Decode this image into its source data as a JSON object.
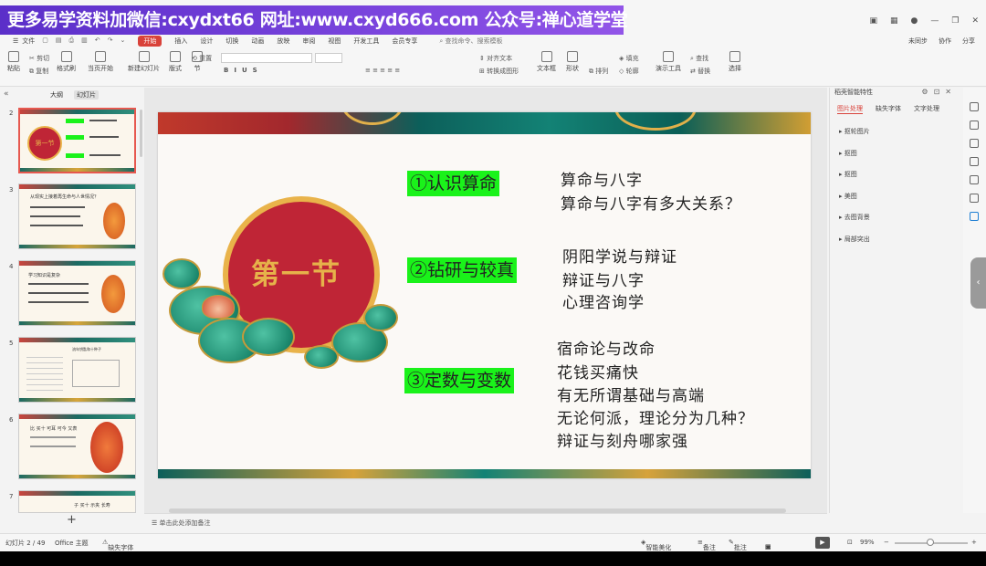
{
  "banner": {
    "text": "更多易学资料加微信:cxydxt66  网址:www.cxyd666.com  公众号:禅心道学堂"
  },
  "menu": {
    "file": "文件",
    "tabs": [
      "开始",
      "插入",
      "设计",
      "切换",
      "动画",
      "放映",
      "审阅",
      "视图",
      "开发工具",
      "会员专享"
    ],
    "active_tab": "开始",
    "search": "查找命令、搜索模板",
    "right": [
      "未同步",
      "协作",
      "分享"
    ]
  },
  "ribbon": {
    "paste": "粘贴",
    "cut": "剪切",
    "copy": "复制",
    "format_painter": "格式刷",
    "current_slide": "当页开始",
    "new_slide": "新建幻灯片",
    "layout": "版式",
    "section": "节",
    "reset": "重置",
    "text_box": "文本框",
    "shape": "形状",
    "arrange": "排列",
    "outline": "轮廓",
    "presentation_tool": "演示工具",
    "replace": "替换",
    "select": "选择",
    "find": "查找",
    "align_text": "对齐文本",
    "convert_smartart": "转换成图形",
    "fill": "填充",
    "format_marks": [
      "B",
      "I",
      "U",
      "S"
    ]
  },
  "left_panel": {
    "tabs": [
      "大纲",
      "幻灯片"
    ],
    "selected_tab": "幻灯片",
    "slides": [
      {
        "num": "2",
        "title": "第一节"
      },
      {
        "num": "3",
        "title": "从现实上接着再生命与人世情况？"
      },
      {
        "num": "4",
        "title": "学习知识是复杂"
      },
      {
        "num": "5",
        "title": "流年钥匙和十种子"
      },
      {
        "num": "6",
        "title": "比 买十 可耳 可今 又表"
      },
      {
        "num": "7",
        "title": "子 买十 示夹 长寿"
      }
    ]
  },
  "slide": {
    "circle_title": "第一节",
    "sections": [
      {
        "heading": "①认识算命",
        "lines": [
          "算命与八字",
          "算命与八字有多大关系？"
        ]
      },
      {
        "heading": "②钻研与较真",
        "lines": [
          "阴阳学说与辩证",
          "辩证与八字",
          "心理咨询学"
        ]
      },
      {
        "heading": "③定数与变数",
        "lines": [
          "宿命论与改命",
          "花钱买痛快",
          "有无所谓基础与高端",
          "无论何派，理论分为几种？",
          "辩证与刻舟哪家强"
        ]
      }
    ],
    "highlight_color": "#1af21a"
  },
  "right_panel": {
    "title": "稻壳智能特性",
    "tabs": [
      "图片处理",
      "缺失字体",
      "文字处理"
    ],
    "selected_tab": "图片处理",
    "items": [
      "抠轮图片",
      "抠图",
      "抠图",
      "美图",
      "去图背景",
      "局部突出"
    ]
  },
  "notes": {
    "placeholder": "单击此处添加备注"
  },
  "status": {
    "slide_info": "幻灯片 2 / 49",
    "theme": "Office 主题",
    "missing_font": "缺失字体",
    "smart_beautify": "智能美化",
    "notes": "备注",
    "comments": "批注",
    "zoom": "99%"
  },
  "colors": {
    "accent": "#d9423a",
    "banner": "#6a3bd6",
    "slide_red": "#bf2536",
    "gold": "#e9b34a",
    "teal": "#138275"
  }
}
